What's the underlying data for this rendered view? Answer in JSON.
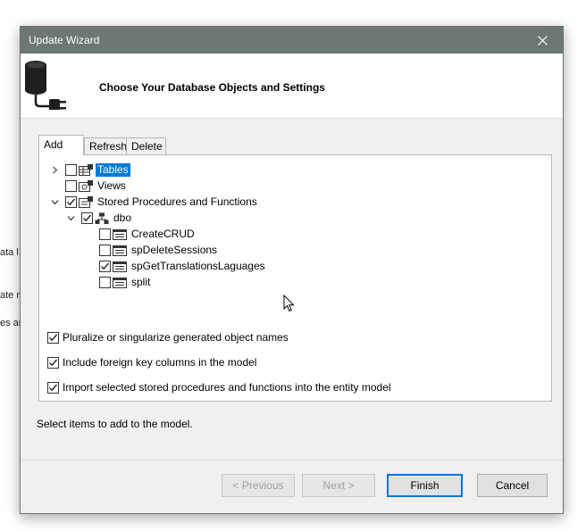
{
  "background_fragments": [
    "ata l",
    "ate n",
    "es ar"
  ],
  "window": {
    "title": "Update Wizard"
  },
  "header": {
    "title": "Choose Your Database Objects and Settings",
    "icon": "database-plug-icon"
  },
  "tabs": [
    {
      "label": "Add",
      "active": true
    },
    {
      "label": "Refresh",
      "active": false
    },
    {
      "label": "Delete",
      "active": false
    }
  ],
  "tree": {
    "tables": {
      "label": "Tables",
      "checked": false,
      "expanded": false,
      "selected": true
    },
    "views": {
      "label": "Views",
      "checked": false
    },
    "procedures": {
      "label": "Stored Procedures and Functions",
      "checked": true,
      "expanded": true
    },
    "schema": {
      "label": "dbo",
      "checked": true,
      "expanded": true
    },
    "items": [
      {
        "label": "CreateCRUD",
        "checked": false
      },
      {
        "label": "spDeleteSessions",
        "checked": false
      },
      {
        "label": "spGetTranslationsLaguages",
        "checked": true
      },
      {
        "label": "split",
        "checked": false
      }
    ]
  },
  "options": [
    {
      "label": "Pluralize or singularize generated object names",
      "checked": true
    },
    {
      "label": "Include foreign key columns in the model",
      "checked": true
    },
    {
      "label": "Import selected stored procedures and functions into the entity model",
      "checked": true
    }
  ],
  "status": "Select items to add to the model.",
  "buttons": {
    "previous": "< Previous",
    "next": "Next >",
    "finish": "Finish",
    "cancel": "Cancel"
  },
  "colors": {
    "titlebar": "#6d7774",
    "selection": "#0078d7",
    "dialog_bg": "#f0f0f0"
  }
}
